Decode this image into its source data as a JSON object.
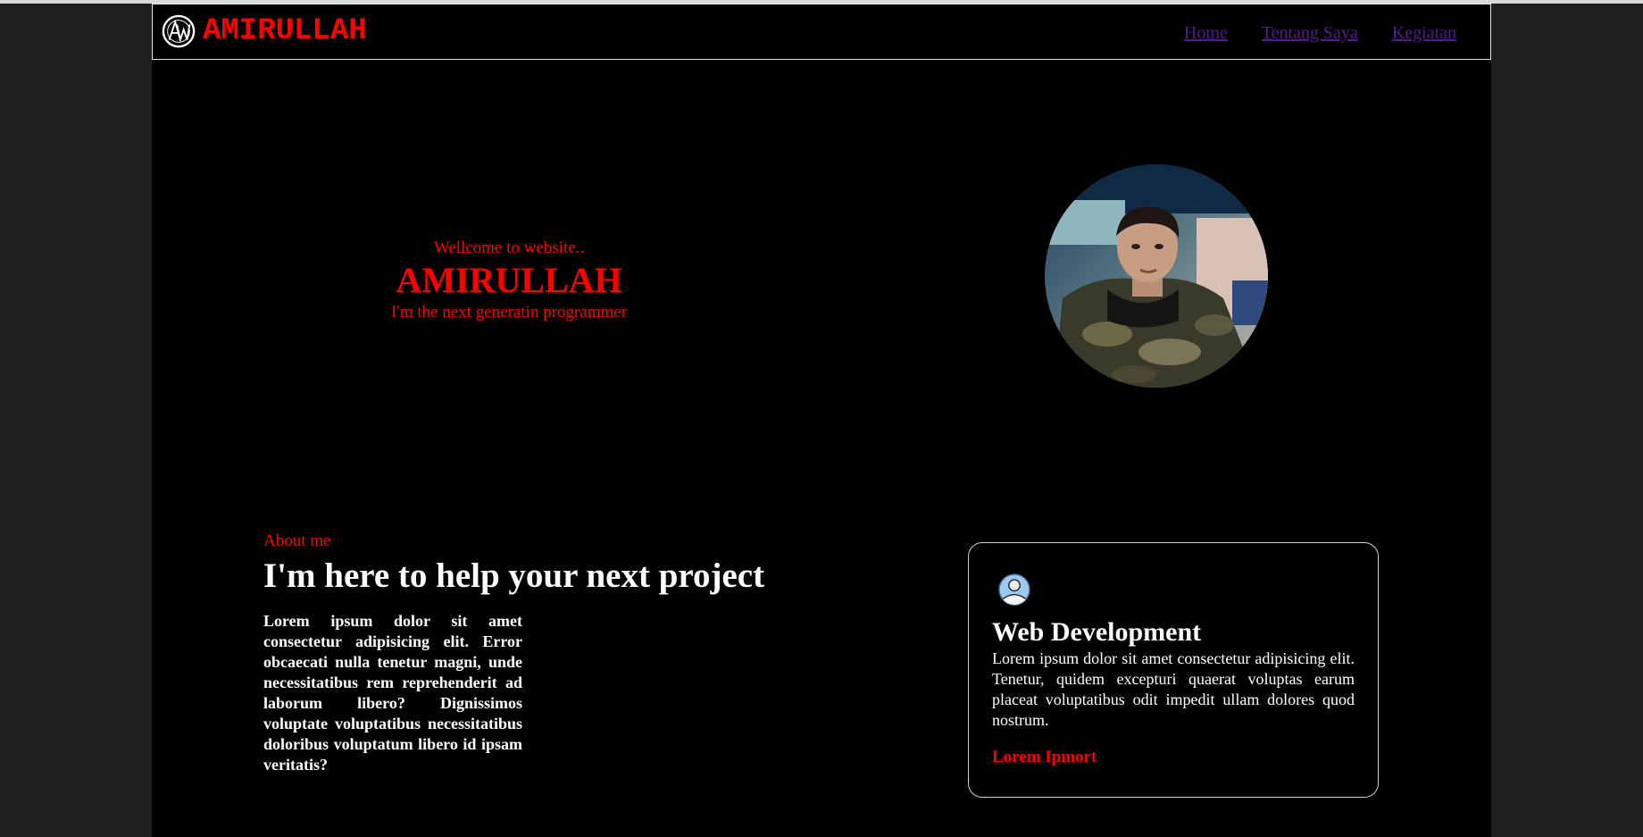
{
  "nav": {
    "brand": "AMIRULLAH",
    "logo_icon": "aw-monogram-icon",
    "links": [
      "Home",
      "Tentang Saya",
      "Kegiatan"
    ],
    "link_color": "#551a8b"
  },
  "hero": {
    "welcome": "Wellcome to website..",
    "name": "AMIRULLAH",
    "tagline": "I'm the next generatin programmer",
    "accent": "#ff0000"
  },
  "about": {
    "kicker": "About me",
    "title": "I'm here to help your next project",
    "text": "Lorem ipsum dolor sit amet consectetur adipisicing elit. Error obcaecati nulla tenetur magni, unde necessitatibus rem reprehenderit ad laborum libero? Dignissimos voluptate voluptatibus necessitatibus doloribus voluptatum libero id ipsam veritatis?"
  },
  "service": {
    "icon": "user-icon",
    "title": "Web Development",
    "text": "Lorem ipsum dolor sit amet consectetur adipisicing elit. Tenetur, quidem excepturi quaerat voluptas earum placeat voluptatibus odit impedit ullam dolores quod nostrum.",
    "link": "Lorem Ipmort"
  }
}
